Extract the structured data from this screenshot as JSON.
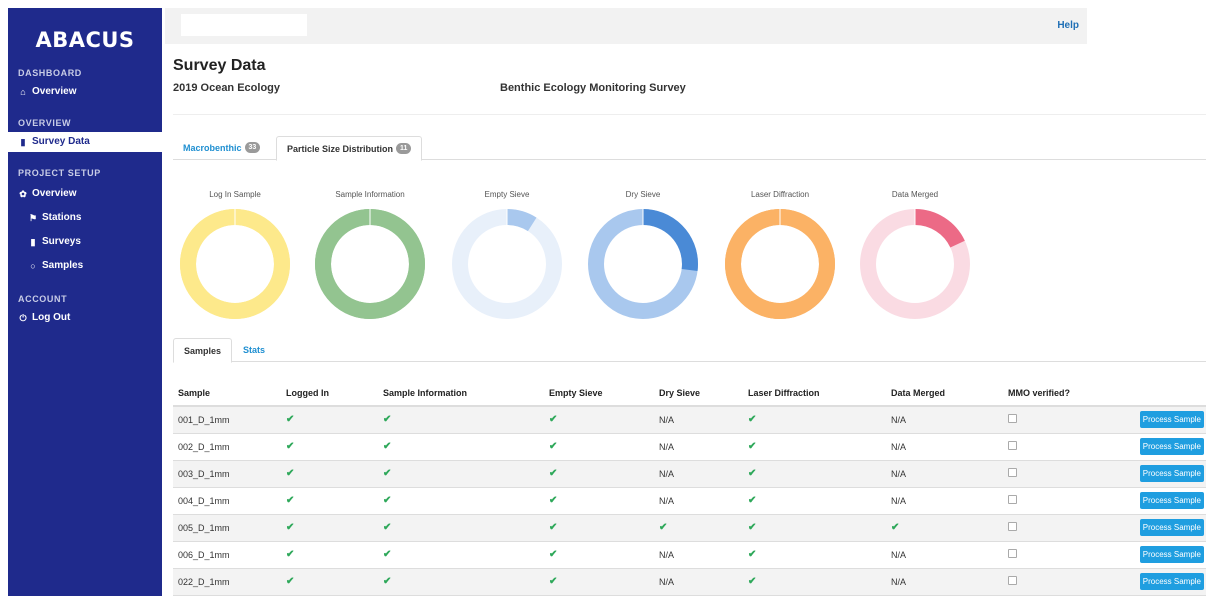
{
  "app": {
    "logo": "ABACUS"
  },
  "sidebar": {
    "sections": [
      {
        "label": "DASHBOARD",
        "items": [
          {
            "label": "Overview",
            "icon": "home-icon"
          }
        ]
      },
      {
        "label": "OVERVIEW",
        "items": [
          {
            "label": "Survey Data",
            "icon": "clipboard-icon",
            "active": true
          }
        ]
      },
      {
        "label": "PROJECT SETUP",
        "items": [
          {
            "label": "Overview",
            "icon": "gear-icon"
          },
          {
            "label": "Stations",
            "icon": "flag-icon"
          },
          {
            "label": "Surveys",
            "icon": "clipboard-icon"
          },
          {
            "label": "Samples",
            "icon": "circle-icon"
          }
        ]
      },
      {
        "label": "ACCOUNT",
        "items": [
          {
            "label": "Log Out",
            "icon": "power-icon"
          }
        ]
      }
    ]
  },
  "topbar": {
    "search_placeholder": "",
    "help": "Help"
  },
  "header": {
    "title": "Survey Data",
    "project": "2019 Ocean Ecology",
    "survey": "Benthic Ecology Monitoring Survey"
  },
  "tabs": [
    {
      "label": "Macrobenthic",
      "badge": "33",
      "active": false
    },
    {
      "label": "Particle Size Distribution",
      "badge": "11",
      "active": true
    }
  ],
  "donuts": [
    {
      "label": "Log In Sample",
      "fraction": 1.0,
      "color": "#fde98b",
      "track": "#fde98b"
    },
    {
      "label": "Sample Information",
      "fraction": 1.0,
      "color": "#93c490",
      "track": "#93c490"
    },
    {
      "label": "Empty Sieve",
      "fraction": 0.09,
      "color": "#a9c8ee",
      "track": "#e8f0fa"
    },
    {
      "label": "Dry Sieve",
      "fraction": 0.27,
      "color": "#4a8ad6",
      "track": "#a9c8ee"
    },
    {
      "label": "Laser Diffraction",
      "fraction": 1.0,
      "color": "#fbb265",
      "track": "#fbb265"
    },
    {
      "label": "Data Merged",
      "fraction": 0.18,
      "color": "#ec6a86",
      "track": "#fadbe3"
    }
  ],
  "subtabs": [
    {
      "label": "Samples",
      "active": true
    },
    {
      "label": "Stats",
      "active": false
    }
  ],
  "table": {
    "columns": [
      "Sample",
      "Logged In",
      "Sample Information",
      "Empty Sieve",
      "Dry Sieve",
      "Laser Diffraction",
      "Data Merged",
      "MMO verified?",
      ""
    ],
    "check_glyph": "✔",
    "button_label": "Process Sample",
    "rows": [
      {
        "sample": "001_D_1mm",
        "logged": "check",
        "info": "check",
        "empty": "check",
        "dry": "N/A",
        "laser": "check",
        "merged": "N/A"
      },
      {
        "sample": "002_D_1mm",
        "logged": "check",
        "info": "check",
        "empty": "check",
        "dry": "N/A",
        "laser": "check",
        "merged": "N/A"
      },
      {
        "sample": "003_D_1mm",
        "logged": "check",
        "info": "check",
        "empty": "check",
        "dry": "N/A",
        "laser": "check",
        "merged": "N/A"
      },
      {
        "sample": "004_D_1mm",
        "logged": "check",
        "info": "check",
        "empty": "check",
        "dry": "N/A",
        "laser": "check",
        "merged": "N/A"
      },
      {
        "sample": "005_D_1mm",
        "logged": "check",
        "info": "check",
        "empty": "check",
        "dry": "check",
        "laser": "check",
        "merged": "check"
      },
      {
        "sample": "006_D_1mm",
        "logged": "check",
        "info": "check",
        "empty": "check",
        "dry": "N/A",
        "laser": "check",
        "merged": "N/A"
      },
      {
        "sample": "022_D_1mm",
        "logged": "check",
        "info": "check",
        "empty": "check",
        "dry": "N/A",
        "laser": "check",
        "merged": "N/A"
      }
    ]
  }
}
